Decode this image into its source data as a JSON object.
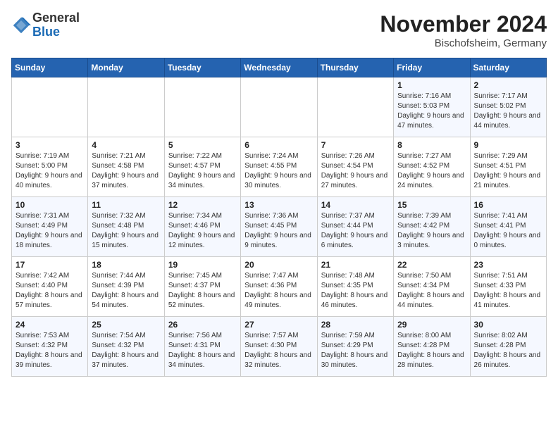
{
  "header": {
    "logo_general": "General",
    "logo_blue": "Blue",
    "title": "November 2024",
    "location": "Bischofsheim, Germany"
  },
  "weekdays": [
    "Sunday",
    "Monday",
    "Tuesday",
    "Wednesday",
    "Thursday",
    "Friday",
    "Saturday"
  ],
  "weeks": [
    [
      {
        "day": "",
        "info": ""
      },
      {
        "day": "",
        "info": ""
      },
      {
        "day": "",
        "info": ""
      },
      {
        "day": "",
        "info": ""
      },
      {
        "day": "",
        "info": ""
      },
      {
        "day": "1",
        "info": "Sunrise: 7:16 AM\nSunset: 5:03 PM\nDaylight: 9 hours and 47 minutes."
      },
      {
        "day": "2",
        "info": "Sunrise: 7:17 AM\nSunset: 5:02 PM\nDaylight: 9 hours and 44 minutes."
      }
    ],
    [
      {
        "day": "3",
        "info": "Sunrise: 7:19 AM\nSunset: 5:00 PM\nDaylight: 9 hours and 40 minutes."
      },
      {
        "day": "4",
        "info": "Sunrise: 7:21 AM\nSunset: 4:58 PM\nDaylight: 9 hours and 37 minutes."
      },
      {
        "day": "5",
        "info": "Sunrise: 7:22 AM\nSunset: 4:57 PM\nDaylight: 9 hours and 34 minutes."
      },
      {
        "day": "6",
        "info": "Sunrise: 7:24 AM\nSunset: 4:55 PM\nDaylight: 9 hours and 30 minutes."
      },
      {
        "day": "7",
        "info": "Sunrise: 7:26 AM\nSunset: 4:54 PM\nDaylight: 9 hours and 27 minutes."
      },
      {
        "day": "8",
        "info": "Sunrise: 7:27 AM\nSunset: 4:52 PM\nDaylight: 9 hours and 24 minutes."
      },
      {
        "day": "9",
        "info": "Sunrise: 7:29 AM\nSunset: 4:51 PM\nDaylight: 9 hours and 21 minutes."
      }
    ],
    [
      {
        "day": "10",
        "info": "Sunrise: 7:31 AM\nSunset: 4:49 PM\nDaylight: 9 hours and 18 minutes."
      },
      {
        "day": "11",
        "info": "Sunrise: 7:32 AM\nSunset: 4:48 PM\nDaylight: 9 hours and 15 minutes."
      },
      {
        "day": "12",
        "info": "Sunrise: 7:34 AM\nSunset: 4:46 PM\nDaylight: 9 hours and 12 minutes."
      },
      {
        "day": "13",
        "info": "Sunrise: 7:36 AM\nSunset: 4:45 PM\nDaylight: 9 hours and 9 minutes."
      },
      {
        "day": "14",
        "info": "Sunrise: 7:37 AM\nSunset: 4:44 PM\nDaylight: 9 hours and 6 minutes."
      },
      {
        "day": "15",
        "info": "Sunrise: 7:39 AM\nSunset: 4:42 PM\nDaylight: 9 hours and 3 minutes."
      },
      {
        "day": "16",
        "info": "Sunrise: 7:41 AM\nSunset: 4:41 PM\nDaylight: 9 hours and 0 minutes."
      }
    ],
    [
      {
        "day": "17",
        "info": "Sunrise: 7:42 AM\nSunset: 4:40 PM\nDaylight: 8 hours and 57 minutes."
      },
      {
        "day": "18",
        "info": "Sunrise: 7:44 AM\nSunset: 4:39 PM\nDaylight: 8 hours and 54 minutes."
      },
      {
        "day": "19",
        "info": "Sunrise: 7:45 AM\nSunset: 4:37 PM\nDaylight: 8 hours and 52 minutes."
      },
      {
        "day": "20",
        "info": "Sunrise: 7:47 AM\nSunset: 4:36 PM\nDaylight: 8 hours and 49 minutes."
      },
      {
        "day": "21",
        "info": "Sunrise: 7:48 AM\nSunset: 4:35 PM\nDaylight: 8 hours and 46 minutes."
      },
      {
        "day": "22",
        "info": "Sunrise: 7:50 AM\nSunset: 4:34 PM\nDaylight: 8 hours and 44 minutes."
      },
      {
        "day": "23",
        "info": "Sunrise: 7:51 AM\nSunset: 4:33 PM\nDaylight: 8 hours and 41 minutes."
      }
    ],
    [
      {
        "day": "24",
        "info": "Sunrise: 7:53 AM\nSunset: 4:32 PM\nDaylight: 8 hours and 39 minutes."
      },
      {
        "day": "25",
        "info": "Sunrise: 7:54 AM\nSunset: 4:32 PM\nDaylight: 8 hours and 37 minutes."
      },
      {
        "day": "26",
        "info": "Sunrise: 7:56 AM\nSunset: 4:31 PM\nDaylight: 8 hours and 34 minutes."
      },
      {
        "day": "27",
        "info": "Sunrise: 7:57 AM\nSunset: 4:30 PM\nDaylight: 8 hours and 32 minutes."
      },
      {
        "day": "28",
        "info": "Sunrise: 7:59 AM\nSunset: 4:29 PM\nDaylight: 8 hours and 30 minutes."
      },
      {
        "day": "29",
        "info": "Sunrise: 8:00 AM\nSunset: 4:28 PM\nDaylight: 8 hours and 28 minutes."
      },
      {
        "day": "30",
        "info": "Sunrise: 8:02 AM\nSunset: 4:28 PM\nDaylight: 8 hours and 26 minutes."
      }
    ]
  ]
}
